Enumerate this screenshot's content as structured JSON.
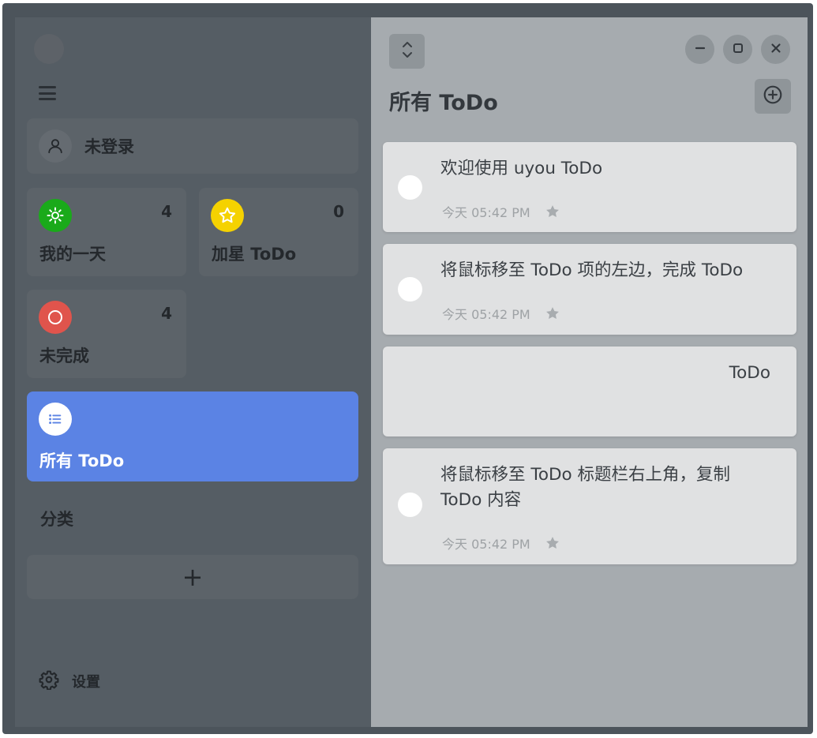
{
  "sidebar": {
    "login_label": "未登录",
    "smart_lists": [
      {
        "label": "我的一天",
        "count": "4",
        "icon": "sun-icon",
        "color": "#1aaa1a"
      },
      {
        "label": "加星 ToDo",
        "count": "0",
        "icon": "star-icon",
        "color": "#f5d200"
      },
      {
        "label": "未完成",
        "count": "4",
        "icon": "circle-icon",
        "color": "#e0544c"
      },
      {
        "label": "所有 ToDo",
        "icon": "list-icon",
        "color": "#ffffff",
        "selected": true
      }
    ],
    "categories_label": "分类",
    "add_category_label": "+",
    "settings_label": "设置"
  },
  "main": {
    "title": "所有 ToDo",
    "todos": [
      {
        "title": "欢迎使用 uyou ToDo",
        "time": "今天 05:42 PM"
      },
      {
        "title": "将鼠标移至 ToDo 项的左边，完成 ToDo",
        "time": "今天 05:42 PM"
      },
      {
        "title": "ToDo",
        "time": ""
      },
      {
        "title": "将鼠标移至 ToDo 标题栏右上角，复制 ToDo 内容",
        "time": "今天 05:42 PM"
      }
    ]
  },
  "colors": {
    "accent": "#5b83e4",
    "sidebar_bg": "#555d64",
    "main_bg": "#a6abaf",
    "card_bg": "#e0e1e2"
  }
}
